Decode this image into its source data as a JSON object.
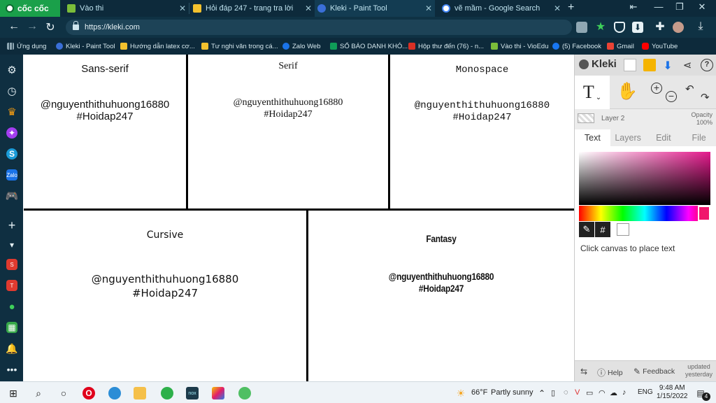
{
  "browser": {
    "brand": "cốc cốc",
    "tabs": [
      {
        "title": "Vào thi",
        "color": "#7bbd3a"
      },
      {
        "title": "Hỏi đáp 247 - trang tra lời",
        "color": "#f2c12e"
      },
      {
        "title": "Kleki - Paint Tool",
        "color": "#3a6fd8"
      },
      {
        "title": "vẽ mầm - Google Search",
        "color": "#ffffff"
      }
    ],
    "url": "https://kleki.com",
    "bookmarks": [
      {
        "label": "Ứng dụng",
        "color": "#8fa7b3"
      },
      {
        "label": "Kleki - Paint Tool",
        "color": "#3a6fd8"
      },
      {
        "label": "Hướng dẫn latex cơ...",
        "color": "#f2c12e"
      },
      {
        "label": "Tư nghi văn trong cá...",
        "color": "#f2c12e"
      },
      {
        "label": "Zalo Web",
        "color": "#1a73e8"
      },
      {
        "label": "SỔ BÁO DANH KHÓ...",
        "color": "#0f9d58"
      },
      {
        "label": "Hộp thư đến (76) - n...",
        "color": "#d93025"
      },
      {
        "label": "Vào thi - VioEdu",
        "color": "#7bbd3a"
      },
      {
        "label": "(5) Facebook",
        "color": "#1877f2"
      },
      {
        "label": "Gmail",
        "color": "#ea4335"
      },
      {
        "label": "YouTube",
        "color": "#ff0000"
      }
    ]
  },
  "canvas": {
    "cells": [
      {
        "font": "Sans-serif",
        "user": "@nguyenthithuhuong16880",
        "tag": "#Hoidap247"
      },
      {
        "font": "Serif",
        "user": "@nguyenthithuhuong16880",
        "tag": "#Hoidap247"
      },
      {
        "font": "Monospace",
        "user": "@nguyenthithuhuong16880",
        "tag": "#Hoidap247"
      },
      {
        "font": "Cursive",
        "user": "@nguyenthithuhuong16880",
        "tag": "#Hoidap247"
      },
      {
        "font": "Fantasy",
        "user": "@nguyenthithuhuong16880",
        "tag": "#Hoidap247"
      }
    ]
  },
  "kleki": {
    "logo": "Kleki",
    "tool_text_glyph": "T",
    "layer_name": "Layer 2",
    "opacity_label": "Opacity",
    "opacity_value": "100%",
    "tabs": [
      "Text",
      "Layers",
      "Edit",
      "File"
    ],
    "active_tab": "Text",
    "hex_button": "#",
    "hint": "Click canvas to place text",
    "help": "Help",
    "feedback": "Feedback",
    "updated_line1": "updated",
    "updated_line2": "yesterday",
    "picker_color": "#e4198c"
  },
  "taskbar": {
    "weather_temp": "66°F",
    "weather_desc": "Partly sunny",
    "lang": "ENG",
    "time": "9:48 AM",
    "date": "1/15/2022",
    "notif_count": "4"
  }
}
